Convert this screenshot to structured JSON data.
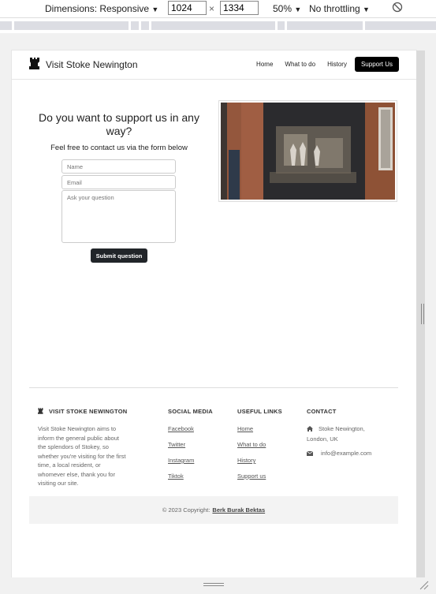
{
  "devtools": {
    "dimensions_label": "Dimensions: Responsive",
    "width": "1024",
    "height": "1334",
    "times": "×",
    "zoom": "50%",
    "throttling": "No throttling",
    "caret": "▼"
  },
  "nav": {
    "brand": "Visit Stoke Newington",
    "links": [
      "Home",
      "What to do",
      "History"
    ],
    "cta": "Support Us"
  },
  "main": {
    "heading": "Do you want to support us in any way?",
    "subheading": "Feel free to contact us via the form below",
    "name_placeholder": "Name",
    "email_placeholder": "Email",
    "question_placeholder": "Ask your question",
    "submit_label": "Submit question"
  },
  "footer": {
    "about": {
      "heading": "VISIT STOKE NEWINGTON",
      "text": "Visit Stoke Newington aims to inform the general public about the splendors of Stokey, so whether you're visiting for the first time, a local resident, or whomever else, thank you for visiting our site."
    },
    "social": {
      "heading": "SOCIAL MEDIA",
      "links": [
        "Facebook",
        "Twitter",
        "Instagram",
        "Tiktok"
      ]
    },
    "useful": {
      "heading": "USEFUL LINKS",
      "links": [
        "Home",
        "What to do",
        "History",
        "Support us"
      ]
    },
    "contact": {
      "heading": "CONTACT",
      "address": "Stoke Newington, London, UK",
      "email": "info@example.com"
    },
    "copyright_prefix": "© 2023 Copyright:",
    "copyright_name": "Berk Burak Bektas"
  }
}
